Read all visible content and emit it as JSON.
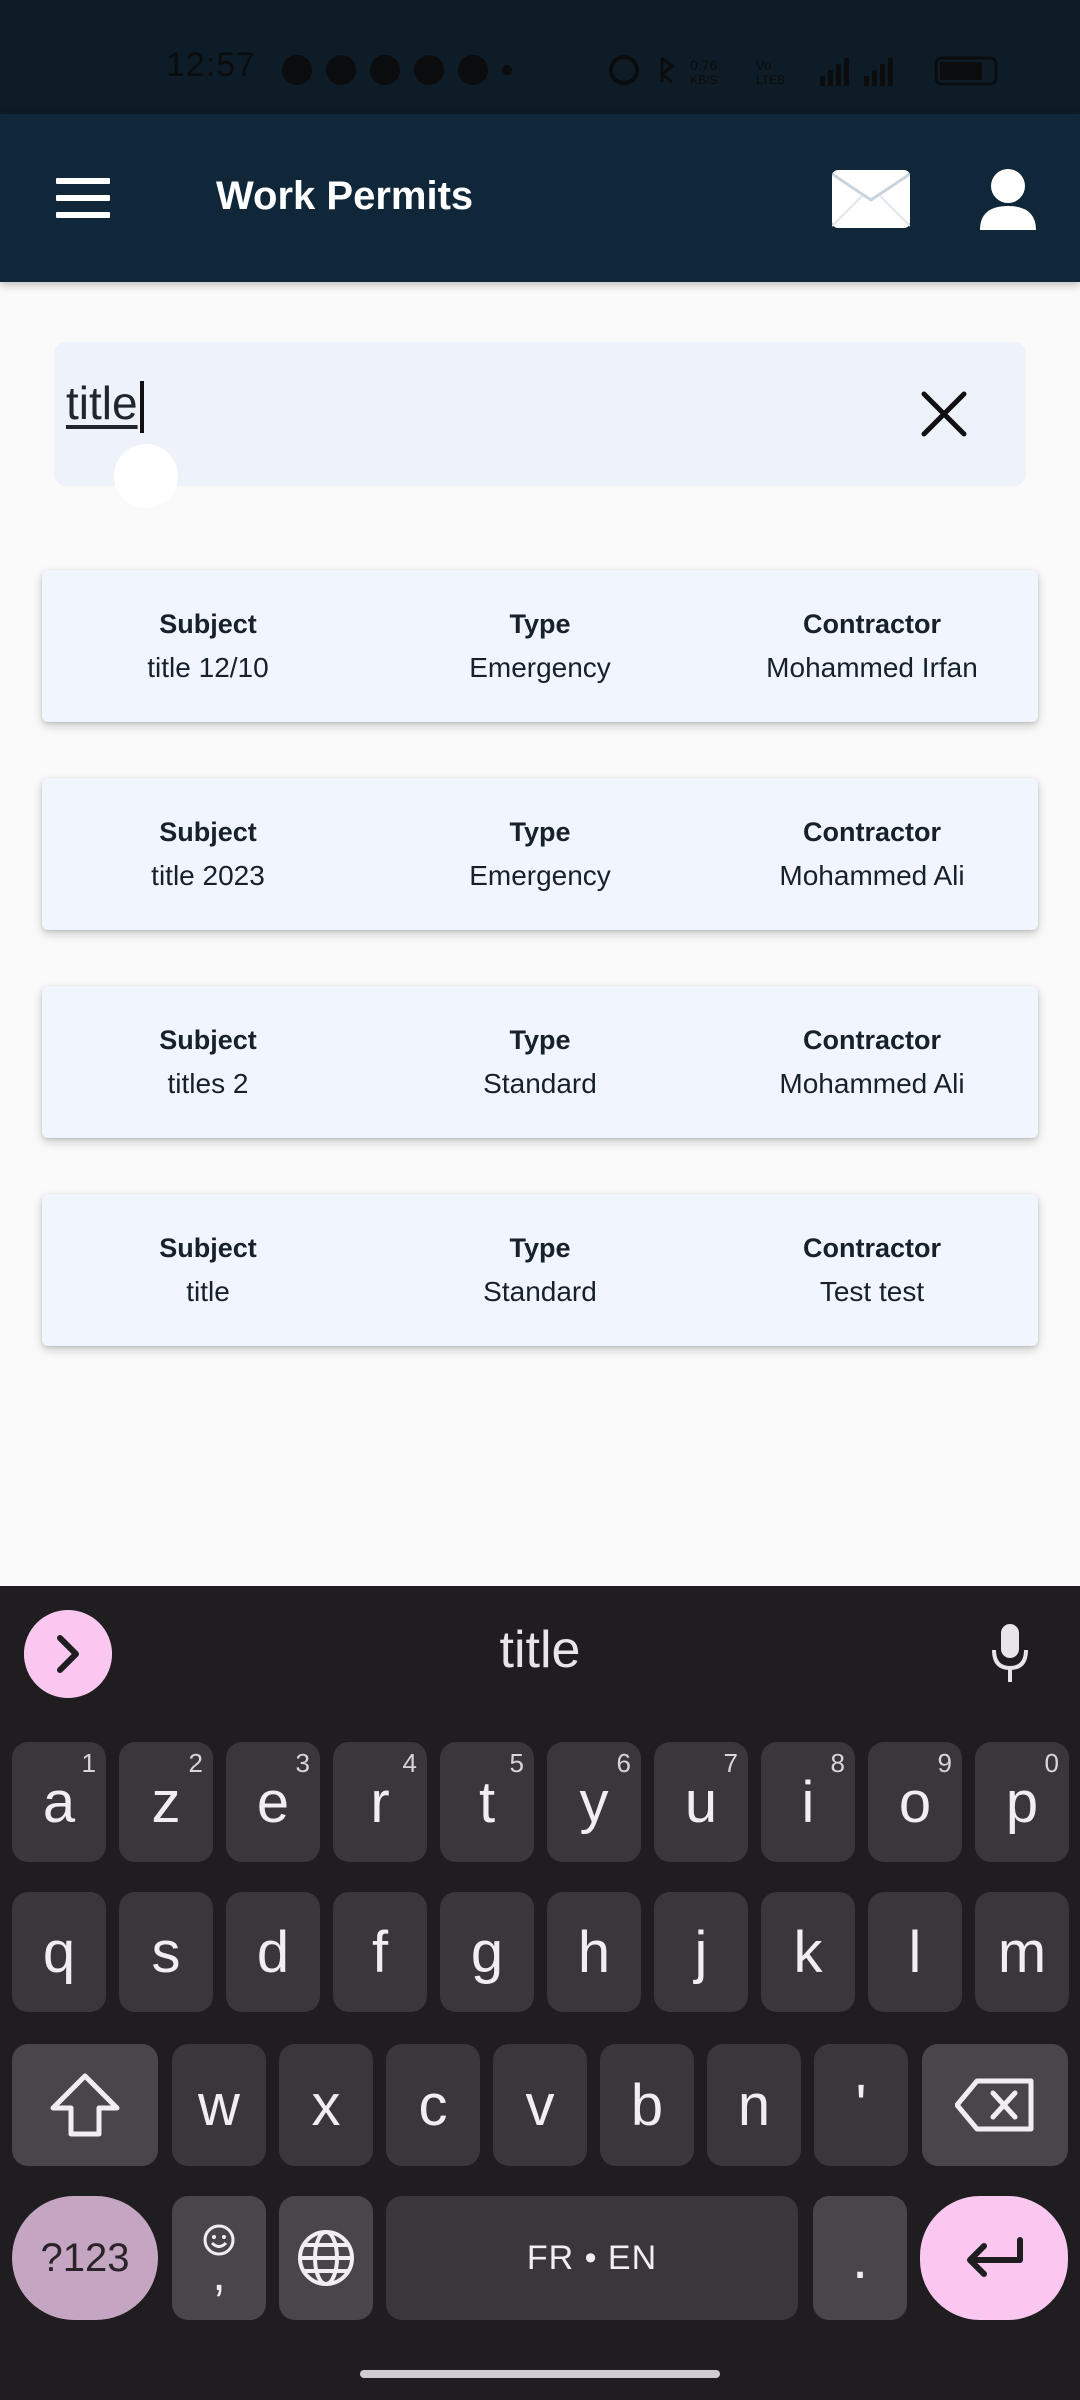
{
  "status_bar": {
    "time": "12:57"
  },
  "app_bar": {
    "title": "Work Permits"
  },
  "search": {
    "value": "title"
  },
  "results": [
    {
      "subject_label": "Subject",
      "subject": "title 12/10",
      "type_label": "Type",
      "type": "Emergency",
      "contractor_label": "Contractor",
      "contractor": "Mohammed Irfan"
    },
    {
      "subject_label": "Subject",
      "subject": "title 2023",
      "type_label": "Type",
      "type": "Emergency",
      "contractor_label": "Contractor",
      "contractor": "Mohammed Ali"
    },
    {
      "subject_label": "Subject",
      "subject": "titles 2",
      "type_label": "Type",
      "type": "Standard",
      "contractor_label": "Contractor",
      "contractor": "Mohammed Ali"
    },
    {
      "subject_label": "Subject",
      "subject": "title",
      "type_label": "Type",
      "type": "Standard",
      "contractor_label": "Contractor",
      "contractor": "Test test"
    }
  ],
  "keyboard": {
    "suggestion": "title",
    "row1": [
      {
        "k": "a",
        "h": "1"
      },
      {
        "k": "z",
        "h": "2"
      },
      {
        "k": "e",
        "h": "3"
      },
      {
        "k": "r",
        "h": "4"
      },
      {
        "k": "t",
        "h": "5"
      },
      {
        "k": "y",
        "h": "6"
      },
      {
        "k": "u",
        "h": "7"
      },
      {
        "k": "i",
        "h": "8"
      },
      {
        "k": "o",
        "h": "9"
      },
      {
        "k": "p",
        "h": "0"
      }
    ],
    "row2": [
      "q",
      "s",
      "d",
      "f",
      "g",
      "h",
      "j",
      "k",
      "l",
      "m"
    ],
    "row3": [
      "w",
      "x",
      "c",
      "v",
      "b",
      "n",
      "'"
    ],
    "symbols_label": "?123",
    "comma": ",",
    "space_label": "FR • EN",
    "period": "."
  },
  "colors": {
    "app_bar": "#0f2738",
    "card_bg": "#f1f5fd",
    "keyboard_bg": "#201d21",
    "accent_pink": "#f9c7f0"
  }
}
